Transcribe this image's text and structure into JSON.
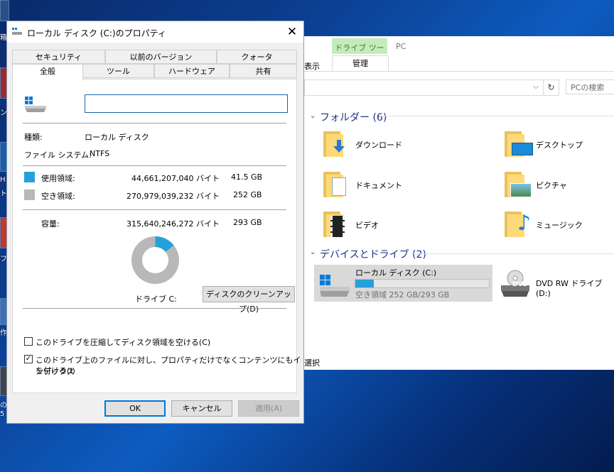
{
  "desktop": {
    "left_edge_glyphs": [
      "箱",
      "ン",
      "H",
      "ト",
      "フ",
      "作",
      "の",
      "5"
    ]
  },
  "explorer": {
    "ribbon": {
      "context_tab": "ドライブ ツール",
      "location": "PC",
      "view_tab_partial": "表示",
      "manage_tab": "管理"
    },
    "address": {
      "refresh_glyph": "↻",
      "dropdown_glyph": "⌵"
    },
    "search": {
      "placeholder": "PCの検索"
    },
    "groups": {
      "folders": {
        "title": "フォルダー (6)"
      },
      "devices": {
        "title": "デバイスとドライブ (2)"
      }
    },
    "folders": [
      {
        "label": "ダウンロード",
        "icon": "download-folder-icon"
      },
      {
        "label": "デスクトップ",
        "icon": "desktop-folder-icon"
      },
      {
        "label": "ドキュメント",
        "icon": "documents-folder-icon"
      },
      {
        "label": "ピクチャ",
        "icon": "pictures-folder-icon"
      },
      {
        "label": "ビデオ",
        "icon": "videos-folder-icon"
      },
      {
        "label": "ミュージック",
        "icon": "music-folder-icon"
      }
    ],
    "drives": [
      {
        "name": "ローカル ディスク (C:)",
        "free_text": "空き領域 252 GB/293 GB",
        "used_fraction": 0.14
      },
      {
        "name": "DVD RW ドライブ (D:)",
        "badge": "DVD"
      }
    ],
    "status_partial": "選択",
    "accent": "#26a0da"
  },
  "dialog": {
    "title": "ローカル ディスク (C:)のプロパティ",
    "close_glyph": "✕",
    "tabs_row1": [
      "セキュリティ",
      "以前のバージョン",
      "クォータ"
    ],
    "tabs_row2": [
      "全般",
      "ツール",
      "ハードウェア",
      "共有"
    ],
    "active_tab": "全般",
    "general": {
      "name_value": "",
      "type_label": "種類:",
      "type_value": "ローカル ディスク",
      "fs_label": "ファイル システム:",
      "fs_value": "NTFS",
      "used_label": "使用領域:",
      "used_bytes": "44,661,207,040 バイト",
      "used_gb": "41.5 GB",
      "free_label": "空き領域:",
      "free_bytes": "270,979,039,232 バイト",
      "free_gb": "252 GB",
      "capacity_label": "容量:",
      "capacity_bytes": "315,640,246,272 バイト",
      "capacity_gb": "293 GB",
      "drive_label": "ドライブ C:",
      "cleanup_button": "ディスクのクリーンアップ(D)",
      "compress_label": "このドライブを圧縮してディスク領域を空ける(C)",
      "compress_checked": false,
      "index_label_line1": "このドライブ上のファイルに対し、プロパティだけでなくコンテンツにもインデックス",
      "index_label_line2": "を付ける(I)",
      "index_checked": true,
      "check_glyph": "✓",
      "used_color": "#26a0da",
      "free_color": "#b8b8b8",
      "used_fraction": 0.142
    },
    "buttons": {
      "ok": "OK",
      "cancel": "キャンセル",
      "apply": "適用(A)"
    }
  }
}
